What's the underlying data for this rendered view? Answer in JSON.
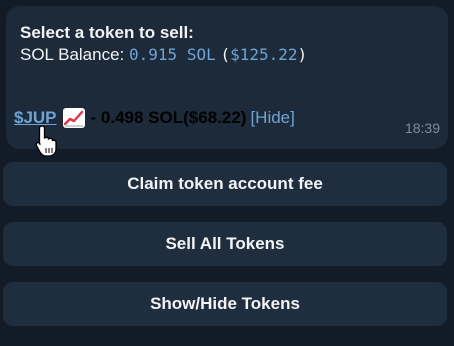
{
  "message": {
    "title": "Select a token to sell:",
    "balance_label": "SOL Balance:",
    "balance_value": "0.915 SOL",
    "balance_usd_open": "(",
    "balance_usd": "$125.22",
    "balance_usd_close": ")",
    "token": {
      "symbol": "$JUP",
      "icon": "chart-increasing-icon",
      "amount_text": "- 0.498 SOL($68.22)",
      "hide_label": "[Hide]"
    },
    "time": "18:39"
  },
  "buttons": {
    "claim_fee": "Claim token account fee",
    "sell_all": "Sell All Tokens",
    "show_hide": "Show/Hide Tokens"
  },
  "colors": {
    "background": "#111c28",
    "bubble": "#1c2a3a",
    "button": "#1f2e3e",
    "link": "#6ea4d6"
  }
}
